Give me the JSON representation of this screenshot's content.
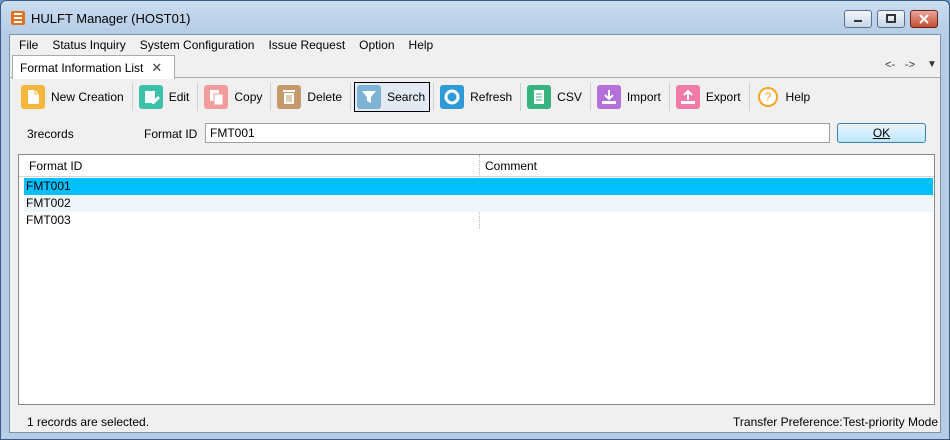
{
  "window": {
    "title": "HULFT Manager (HOST01)",
    "accent": "#00bfff"
  },
  "menu": {
    "items": [
      "File",
      "Status Inquiry",
      "System Configuration",
      "Issue Request",
      "Option",
      "Help"
    ]
  },
  "tabs": {
    "active_label": "Format Information List",
    "nav_back": "<-",
    "nav_forward": "->",
    "overflow": "▼"
  },
  "toolbar": {
    "buttons": [
      {
        "label": "New Creation",
        "icon": "new-creation-icon",
        "color": "#f6b73c"
      },
      {
        "label": "Edit",
        "icon": "edit-icon",
        "color": "#3cc1a8"
      },
      {
        "label": "Copy",
        "icon": "copy-icon",
        "color": "#f29c9c"
      },
      {
        "label": "Delete",
        "icon": "trash-icon",
        "color": "#c49a6c"
      },
      {
        "label": "Search",
        "icon": "filter-icon",
        "color": "#7fb3d5"
      },
      {
        "label": "Refresh",
        "icon": "refresh-icon",
        "color": "#2e9bd6"
      },
      {
        "label": "CSV",
        "icon": "csv-icon",
        "color": "#36b37e"
      },
      {
        "label": "Import",
        "icon": "import-icon",
        "color": "#b56fd8"
      },
      {
        "label": "Export",
        "icon": "export-icon",
        "color": "#f07aa8"
      },
      {
        "label": "Help",
        "icon": "help-icon",
        "color": "#f5a623"
      }
    ]
  },
  "filter": {
    "record_count": "3records",
    "format_id_label": "Format ID",
    "format_id_value": "FMT001",
    "ok_label": "OK"
  },
  "grid": {
    "columns": [
      "Format ID",
      "Comment"
    ],
    "rows": [
      {
        "format_id": "FMT001",
        "comment": ""
      },
      {
        "format_id": "FMT002",
        "comment": ""
      },
      {
        "format_id": "FMT003",
        "comment": ""
      }
    ],
    "selected_index": 0
  },
  "status": {
    "left": "1 records are selected.",
    "right": "Transfer Preference:Test-priority Mode"
  }
}
